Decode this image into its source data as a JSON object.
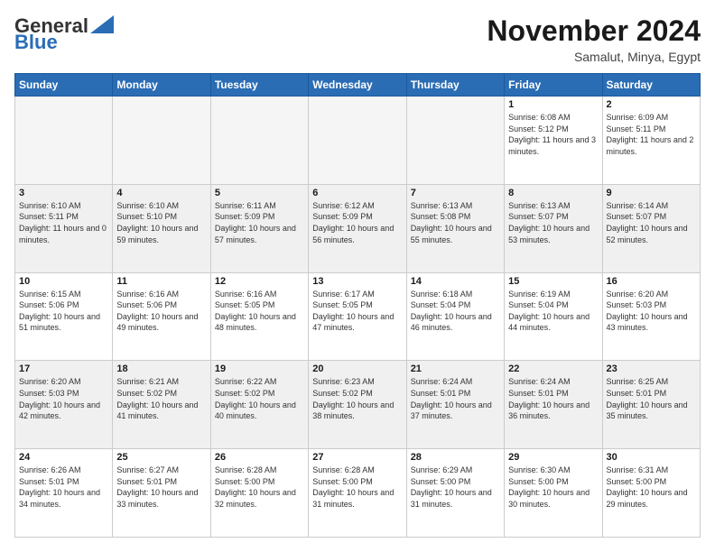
{
  "header": {
    "logo_line1": "General",
    "logo_line2": "Blue",
    "month_title": "November 2024",
    "location": "Samalut, Minya, Egypt"
  },
  "days_of_week": [
    "Sunday",
    "Monday",
    "Tuesday",
    "Wednesday",
    "Thursday",
    "Friday",
    "Saturday"
  ],
  "weeks": [
    [
      {
        "day": "",
        "empty": true
      },
      {
        "day": "",
        "empty": true
      },
      {
        "day": "",
        "empty": true
      },
      {
        "day": "",
        "empty": true
      },
      {
        "day": "",
        "empty": true
      },
      {
        "day": "1",
        "sunrise": "6:08 AM",
        "sunset": "5:12 PM",
        "daylight": "11 hours and 3 minutes."
      },
      {
        "day": "2",
        "sunrise": "6:09 AM",
        "sunset": "5:11 PM",
        "daylight": "11 hours and 2 minutes."
      }
    ],
    [
      {
        "day": "3",
        "sunrise": "6:10 AM",
        "sunset": "5:11 PM",
        "daylight": "11 hours and 0 minutes."
      },
      {
        "day": "4",
        "sunrise": "6:10 AM",
        "sunset": "5:10 PM",
        "daylight": "10 hours and 59 minutes."
      },
      {
        "day": "5",
        "sunrise": "6:11 AM",
        "sunset": "5:09 PM",
        "daylight": "10 hours and 57 minutes."
      },
      {
        "day": "6",
        "sunrise": "6:12 AM",
        "sunset": "5:09 PM",
        "daylight": "10 hours and 56 minutes."
      },
      {
        "day": "7",
        "sunrise": "6:13 AM",
        "sunset": "5:08 PM",
        "daylight": "10 hours and 55 minutes."
      },
      {
        "day": "8",
        "sunrise": "6:13 AM",
        "sunset": "5:07 PM",
        "daylight": "10 hours and 53 minutes."
      },
      {
        "day": "9",
        "sunrise": "6:14 AM",
        "sunset": "5:07 PM",
        "daylight": "10 hours and 52 minutes."
      }
    ],
    [
      {
        "day": "10",
        "sunrise": "6:15 AM",
        "sunset": "5:06 PM",
        "daylight": "10 hours and 51 minutes."
      },
      {
        "day": "11",
        "sunrise": "6:16 AM",
        "sunset": "5:06 PM",
        "daylight": "10 hours and 49 minutes."
      },
      {
        "day": "12",
        "sunrise": "6:16 AM",
        "sunset": "5:05 PM",
        "daylight": "10 hours and 48 minutes."
      },
      {
        "day": "13",
        "sunrise": "6:17 AM",
        "sunset": "5:05 PM",
        "daylight": "10 hours and 47 minutes."
      },
      {
        "day": "14",
        "sunrise": "6:18 AM",
        "sunset": "5:04 PM",
        "daylight": "10 hours and 46 minutes."
      },
      {
        "day": "15",
        "sunrise": "6:19 AM",
        "sunset": "5:04 PM",
        "daylight": "10 hours and 44 minutes."
      },
      {
        "day": "16",
        "sunrise": "6:20 AM",
        "sunset": "5:03 PM",
        "daylight": "10 hours and 43 minutes."
      }
    ],
    [
      {
        "day": "17",
        "sunrise": "6:20 AM",
        "sunset": "5:03 PM",
        "daylight": "10 hours and 42 minutes."
      },
      {
        "day": "18",
        "sunrise": "6:21 AM",
        "sunset": "5:02 PM",
        "daylight": "10 hours and 41 minutes."
      },
      {
        "day": "19",
        "sunrise": "6:22 AM",
        "sunset": "5:02 PM",
        "daylight": "10 hours and 40 minutes."
      },
      {
        "day": "20",
        "sunrise": "6:23 AM",
        "sunset": "5:02 PM",
        "daylight": "10 hours and 38 minutes."
      },
      {
        "day": "21",
        "sunrise": "6:24 AM",
        "sunset": "5:01 PM",
        "daylight": "10 hours and 37 minutes."
      },
      {
        "day": "22",
        "sunrise": "6:24 AM",
        "sunset": "5:01 PM",
        "daylight": "10 hours and 36 minutes."
      },
      {
        "day": "23",
        "sunrise": "6:25 AM",
        "sunset": "5:01 PM",
        "daylight": "10 hours and 35 minutes."
      }
    ],
    [
      {
        "day": "24",
        "sunrise": "6:26 AM",
        "sunset": "5:01 PM",
        "daylight": "10 hours and 34 minutes."
      },
      {
        "day": "25",
        "sunrise": "6:27 AM",
        "sunset": "5:01 PM",
        "daylight": "10 hours and 33 minutes."
      },
      {
        "day": "26",
        "sunrise": "6:28 AM",
        "sunset": "5:00 PM",
        "daylight": "10 hours and 32 minutes."
      },
      {
        "day": "27",
        "sunrise": "6:28 AM",
        "sunset": "5:00 PM",
        "daylight": "10 hours and 31 minutes."
      },
      {
        "day": "28",
        "sunrise": "6:29 AM",
        "sunset": "5:00 PM",
        "daylight": "10 hours and 31 minutes."
      },
      {
        "day": "29",
        "sunrise": "6:30 AM",
        "sunset": "5:00 PM",
        "daylight": "10 hours and 30 minutes."
      },
      {
        "day": "30",
        "sunrise": "6:31 AM",
        "sunset": "5:00 PM",
        "daylight": "10 hours and 29 minutes."
      }
    ]
  ]
}
